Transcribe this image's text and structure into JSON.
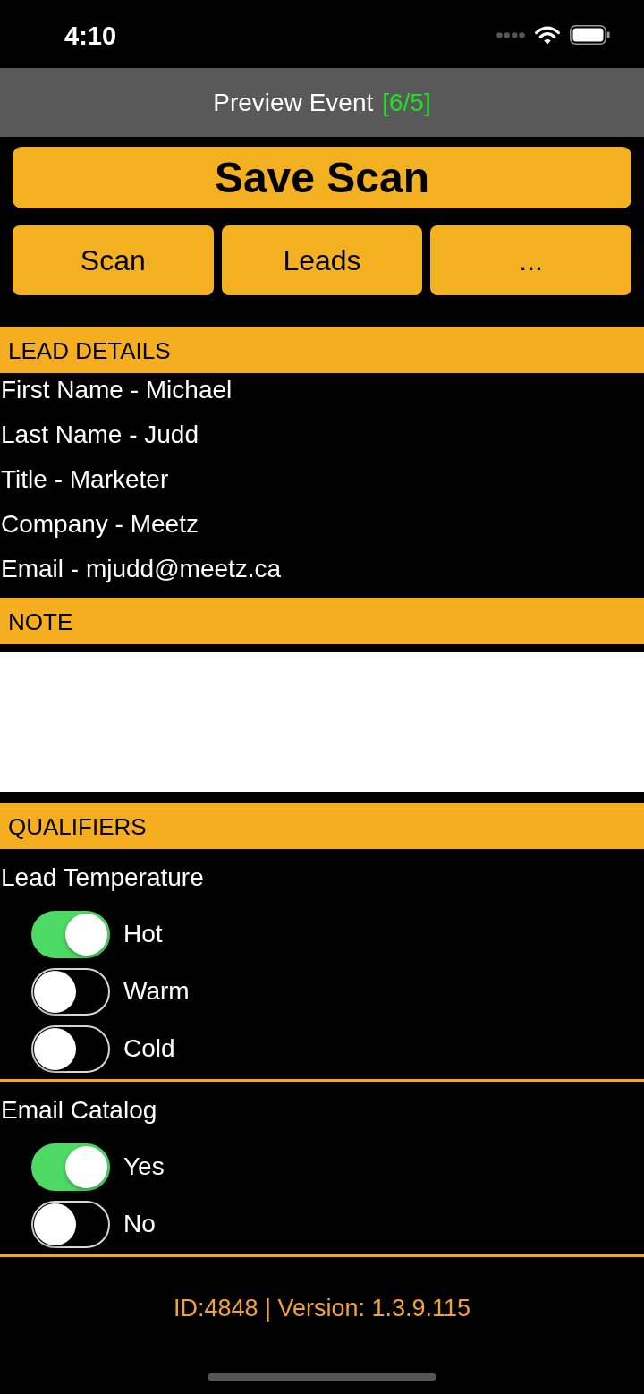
{
  "status_bar": {
    "time": "4:10"
  },
  "header": {
    "title": "Preview Event",
    "counter": "[6/5]"
  },
  "primary_button": {
    "label": "Save Scan"
  },
  "buttons": [
    {
      "label": "Scan"
    },
    {
      "label": "Leads"
    },
    {
      "label": "..."
    }
  ],
  "lead_details": {
    "heading": "LEAD DETAILS",
    "lines": [
      "First Name - Michael",
      "Last Name - Judd",
      "Title - Marketer",
      "Company - Meetz",
      "Email - mjudd@meetz.ca"
    ]
  },
  "note": {
    "heading": "NOTE"
  },
  "qualifiers": {
    "heading": "QUALIFIERS",
    "groups": [
      {
        "title": "Lead Temperature",
        "options": [
          {
            "label": "Hot",
            "on": true
          },
          {
            "label": "Warm",
            "on": false
          },
          {
            "label": "Cold",
            "on": false
          }
        ]
      },
      {
        "title": "Email Catalog",
        "options": [
          {
            "label": "Yes",
            "on": true
          },
          {
            "label": "No",
            "on": false
          }
        ]
      }
    ]
  },
  "footer": {
    "text": "ID:4848 | Version: 1.3.9.115"
  }
}
